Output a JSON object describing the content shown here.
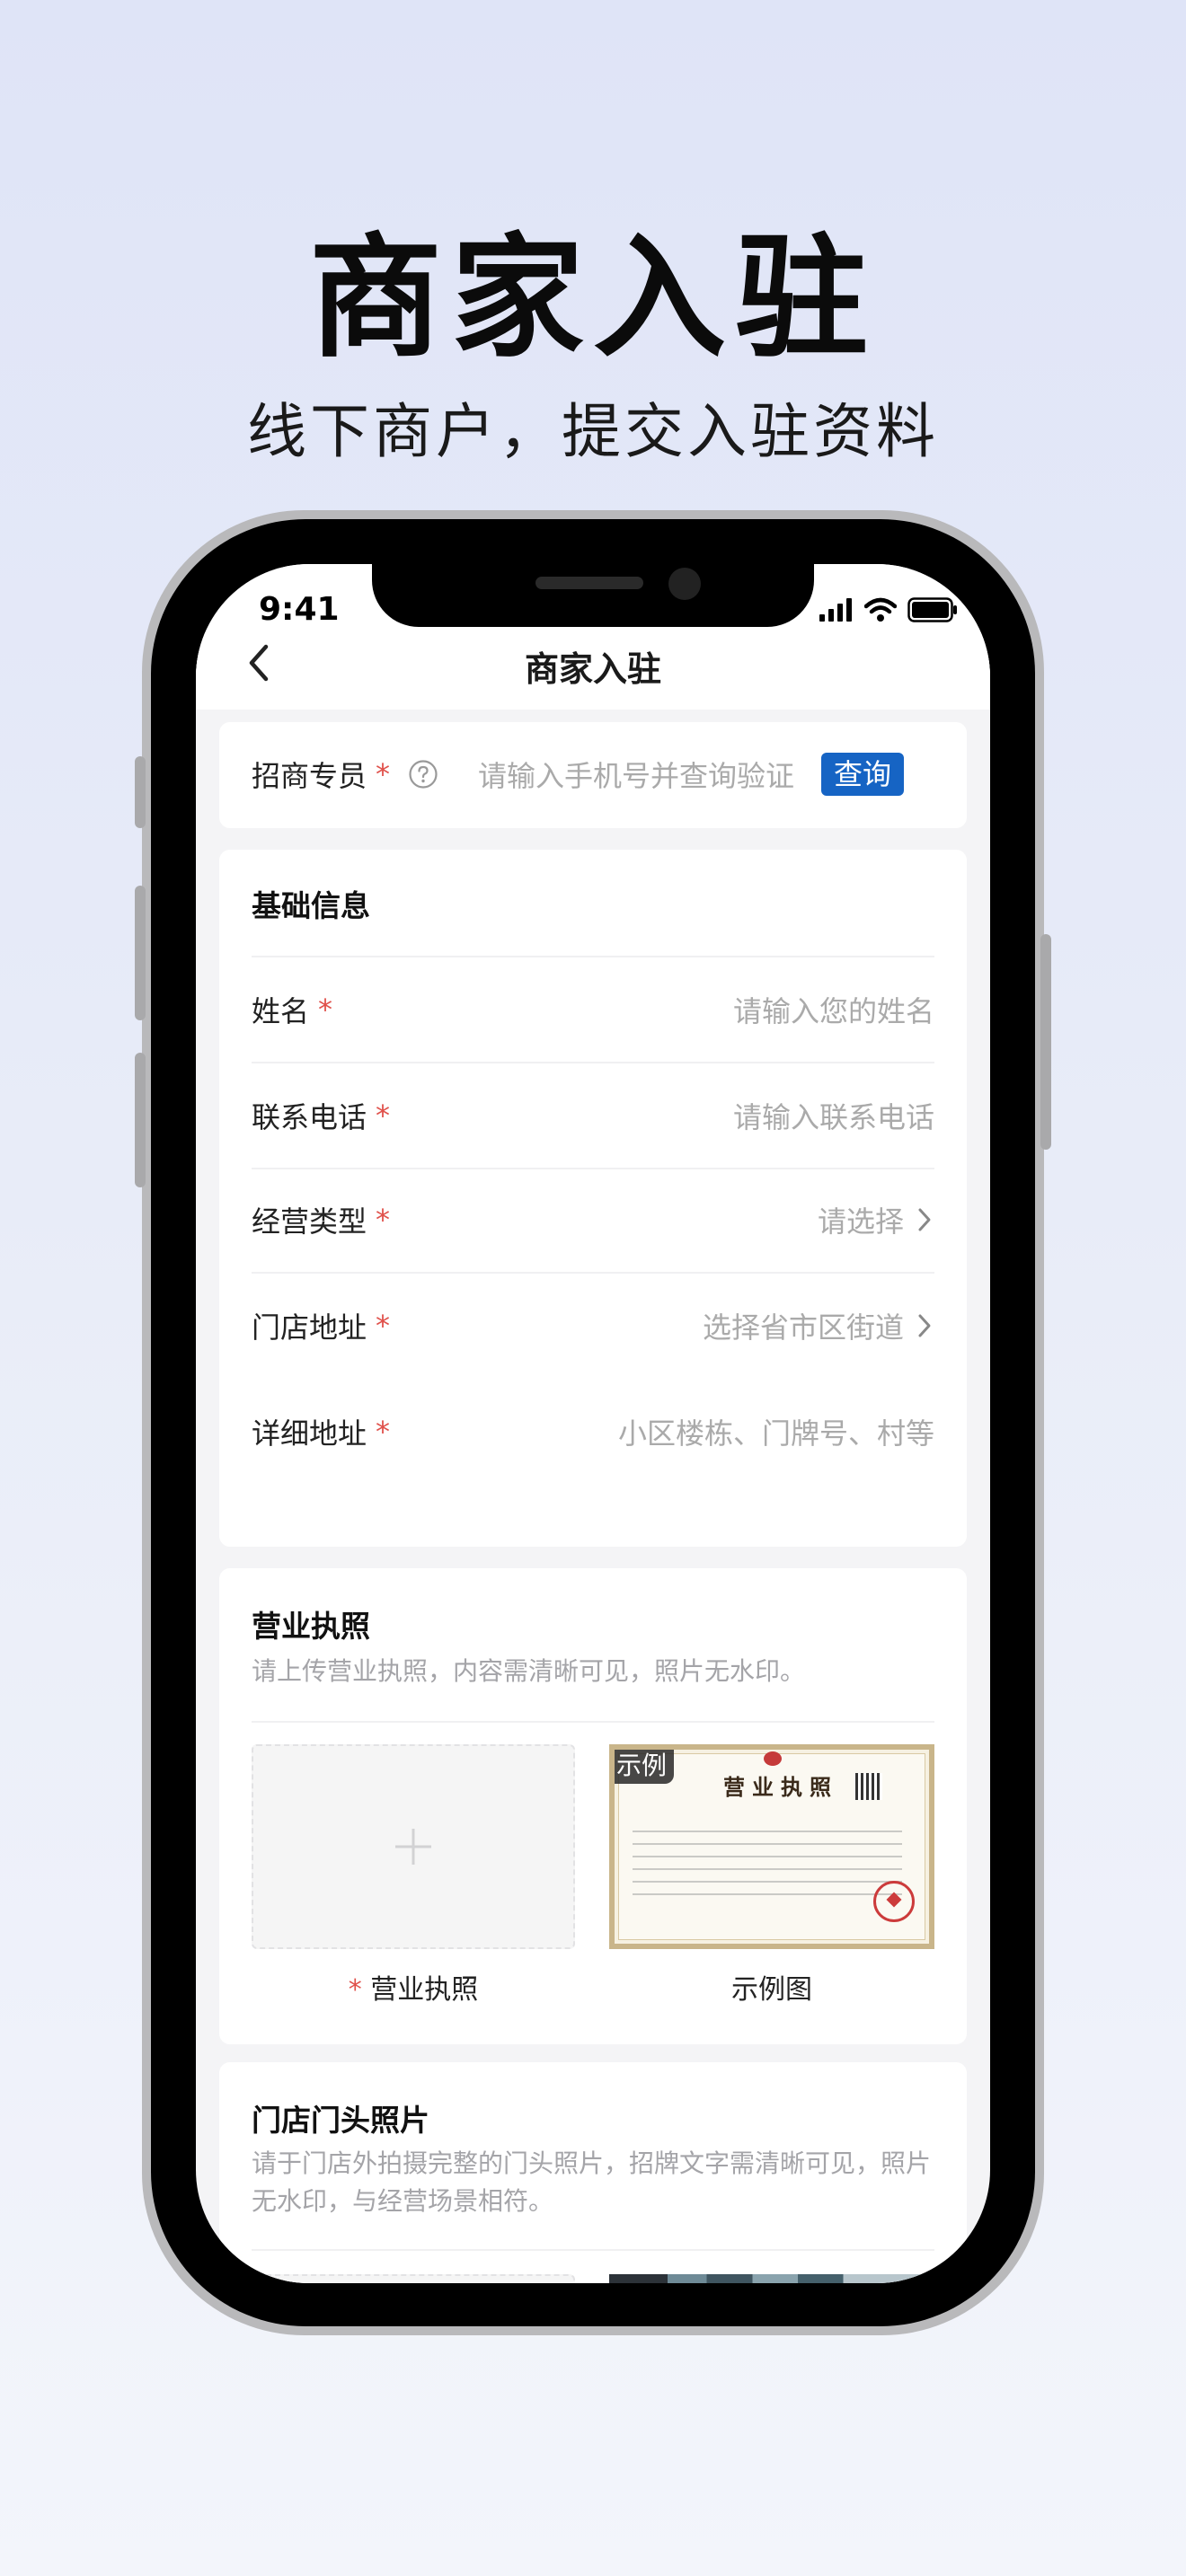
{
  "hero": {
    "title": "商家入驻",
    "subtitle": "线下商户，提交入驻资料"
  },
  "status_bar": {
    "time": "9:41"
  },
  "nav": {
    "title": "商家入驻"
  },
  "agent": {
    "label": "招商专员",
    "required_mark": "*",
    "placeholder": "请输入手机号并查询验证",
    "query_button": "查询"
  },
  "basic_info": {
    "title": "基础信息",
    "fields": [
      {
        "label": "姓名",
        "required_mark": "*",
        "value": "请输入您的姓名"
      },
      {
        "label": "联系电话",
        "required_mark": "*",
        "value": "请输入联系电话"
      },
      {
        "label": "经营类型",
        "required_mark": "*",
        "value": "请选择"
      },
      {
        "label": "门店地址",
        "required_mark": "*",
        "value": "选择省市区街道"
      },
      {
        "label": "详细地址",
        "required_mark": "*",
        "value": "小区楼栋、门牌号、村等"
      }
    ]
  },
  "license": {
    "title": "营业执照",
    "desc": "请上传营业执照，内容需清晰可见，照片无水印。",
    "upload_required_mark": "*",
    "upload_label": "营业执照",
    "example_badge": "示例",
    "example_label": "示例图",
    "example_doc_title": "营业执照"
  },
  "storefront": {
    "title": "门店门头照片",
    "desc": "请于门店外拍摄完整的门头照片，招牌文字需清晰可见，照片无水印，与经营场景相符。"
  },
  "colors": {
    "accent": "#1664c4",
    "required": "#e0514b",
    "placeholder": "#aaaaaa",
    "background_top": "#dfe4f7"
  }
}
